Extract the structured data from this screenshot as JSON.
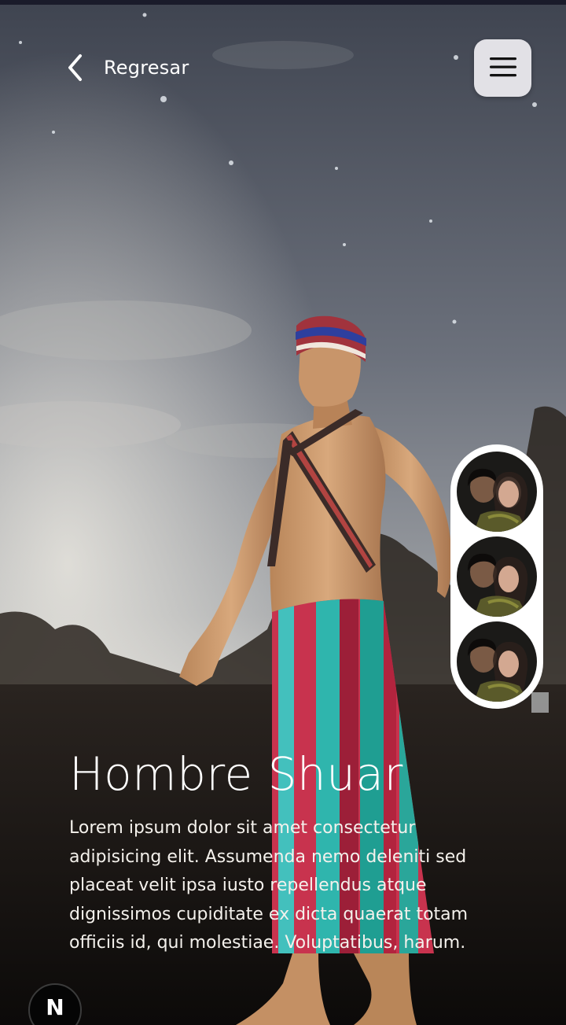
{
  "header": {
    "back_label": "Regresar",
    "back_icon": "chevron-left-icon",
    "menu_icon": "hamburger-menu-icon"
  },
  "gallery": {
    "thumbnails": [
      {
        "icon": "photo-thumbnail"
      },
      {
        "icon": "photo-thumbnail"
      },
      {
        "icon": "photo-thumbnail"
      }
    ]
  },
  "content": {
    "title": "Hombre Shuar",
    "description_lines": [
      "Lorem ipsum dolor sit amet consectetur",
      "adipisicing elit. Assumenda nemo deleniti sed",
      "placeat velit ipsa iusto repellendus atque",
      "dignissimos cupiditate ex dicta quaerat totam",
      "officiis id, qui molestiae. Voluptatibus, harum."
    ]
  },
  "badge": {
    "label": "N"
  },
  "colors": {
    "menu_button_bg": "#e2e1e6",
    "skirt_red": "#c8334e",
    "skirt_teal": "#2fb5ad",
    "skin": "#c9966a",
    "thumb_panel": "#ffffff"
  }
}
